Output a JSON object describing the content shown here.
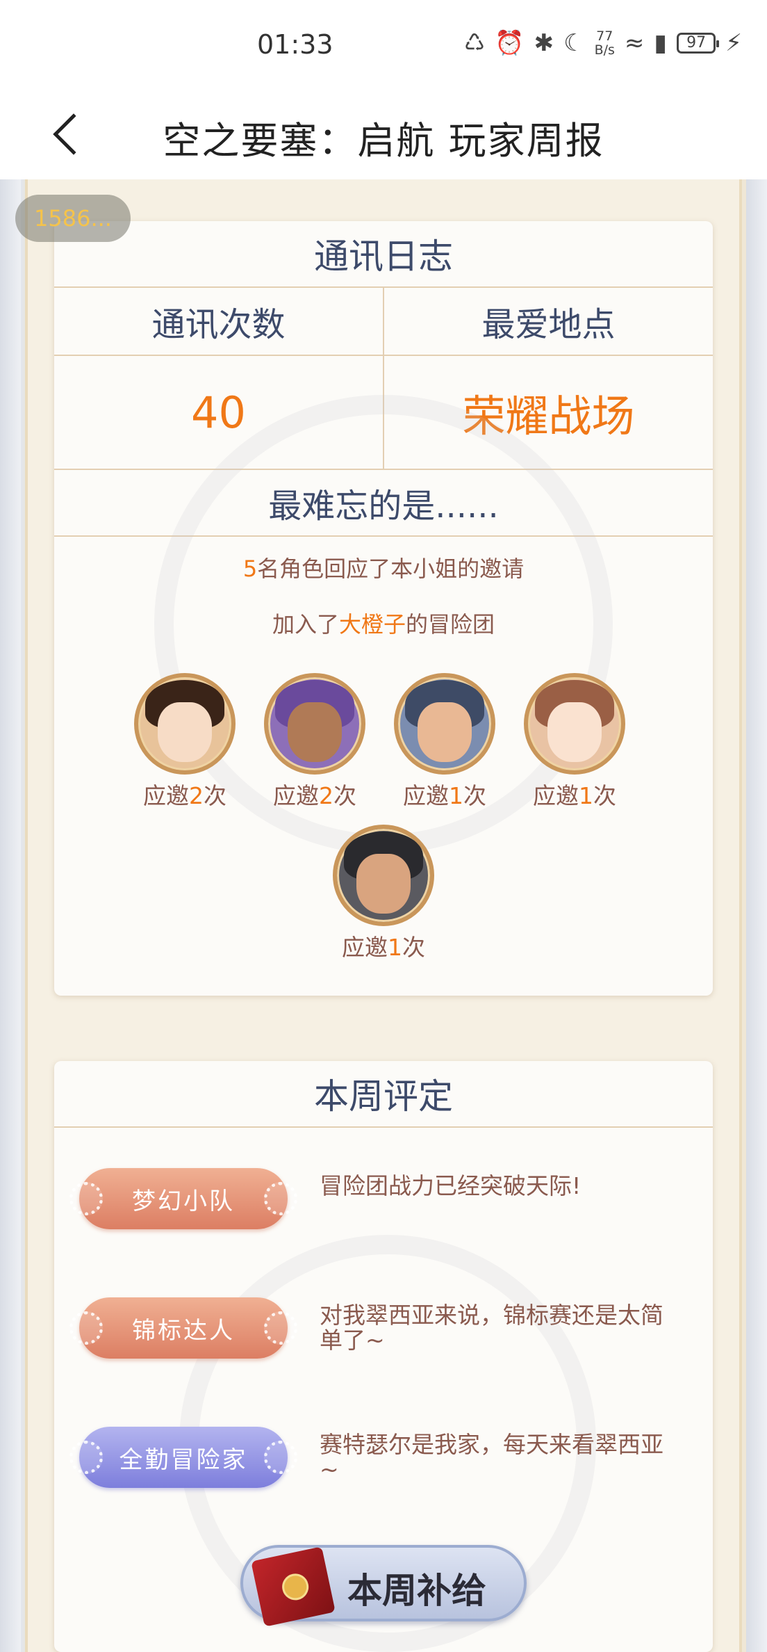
{
  "status_bar": {
    "time": "01:33",
    "net_speed_value": "77",
    "net_speed_unit": "B/s",
    "battery": "97",
    "icons": [
      "sync-icon",
      "alarm-icon",
      "bluetooth-icon",
      "moon-icon",
      "wifi-icon",
      "signal-5g-icon",
      "charging-icon"
    ]
  },
  "nav": {
    "title": "空之要塞：启航 玩家周报"
  },
  "id_chip": "1586...",
  "comm_log": {
    "title": "通讯日志",
    "count_label": "通讯次数",
    "place_label": "最爱地点",
    "count_value": "40",
    "place_value": "荣耀战场",
    "memorable_label": "最难忘的是......",
    "line1_number": "5",
    "line1_text": "名角色回应了本小姐的邀请",
    "line2_prefix": "加入了",
    "line2_name": "大橙子",
    "line2_suffix": "的冒险团",
    "heroes": [
      {
        "prefix": "应邀",
        "count": "2",
        "suffix": "次"
      },
      {
        "prefix": "应邀",
        "count": "2",
        "suffix": "次"
      },
      {
        "prefix": "应邀",
        "count": "1",
        "suffix": "次"
      },
      {
        "prefix": "应邀",
        "count": "1",
        "suffix": "次"
      },
      {
        "prefix": "应邀",
        "count": "1",
        "suffix": "次"
      }
    ]
  },
  "rating": {
    "title": "本周评定",
    "badges": [
      {
        "label": "梦幻小队",
        "desc": "冒险团战力已经突破天际!",
        "color": "#dc7e63"
      },
      {
        "label": "锦标达人",
        "desc": "对我翠西亚来说，锦标赛还是太简单了~",
        "color": "#dc7e63"
      },
      {
        "label": "全勤冒险家",
        "desc": "赛特瑟尔是我家，每天来看翠西亚~",
        "color": "#7d7edc"
      }
    ],
    "supply_button": "本周补给"
  },
  "colors": {
    "accent_orange": "#f07817",
    "heading_blue": "#3d4a6a",
    "body_brown": "#8a5a4e"
  }
}
